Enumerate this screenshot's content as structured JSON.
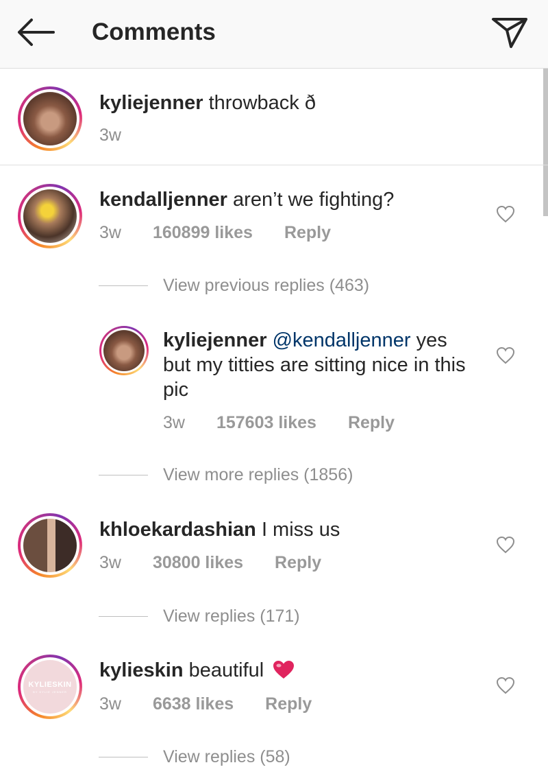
{
  "header": {
    "title": "Comments"
  },
  "caption": {
    "username": "kyliejenner",
    "text": "throwback ð",
    "time": "3w"
  },
  "comments": [
    {
      "username": "kendalljenner",
      "text": "aren’t we fighting?",
      "time": "3w",
      "likes": "160899 likes",
      "reply_label": "Reply",
      "view_replies": "View previous replies (463)"
    },
    {
      "username": "khloekardashian",
      "text": "I miss us",
      "time": "3w",
      "likes": "30800 likes",
      "reply_label": "Reply",
      "view_replies": "View replies (171)"
    },
    {
      "username": "kylieskin",
      "text": "beautiful",
      "time": "3w",
      "likes": "6638 likes",
      "reply_label": "Reply",
      "view_replies": "View replies (58)"
    }
  ],
  "nested_reply": {
    "username": "kyliejenner",
    "mention": "@kendalljenner",
    "text": "yes but my titties are sitting nice in this pic",
    "time": "3w",
    "likes": "157603 likes",
    "reply_label": "Reply",
    "view_more": "View more replies (1856)"
  },
  "avatar_logo": {
    "brand": "KYLIESKIN",
    "sub": "BY KYLIE JENNER"
  },
  "icons": {
    "back": "arrow-left-icon",
    "send": "paper-plane-icon",
    "like": "heart-outline-icon",
    "emoji": "red-heart-emoji"
  },
  "colors": {
    "text": "#262626",
    "muted": "#8e8e8e",
    "mention": "#003569"
  }
}
